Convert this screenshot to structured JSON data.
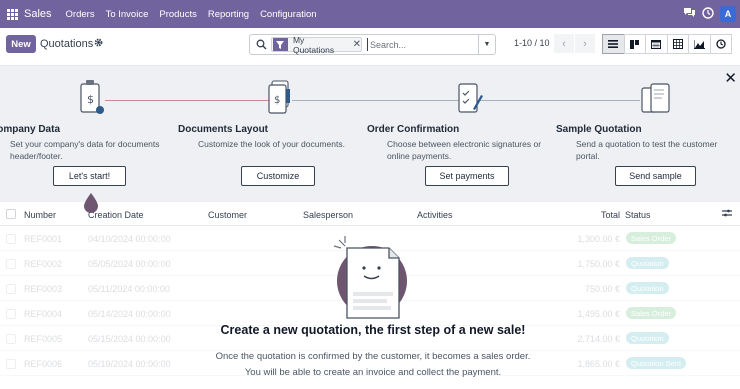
{
  "navbar": {
    "app_name": "Sales",
    "menu": [
      "Orders",
      "To Invoice",
      "Products",
      "Reporting",
      "Configuration"
    ],
    "user_initial": "A",
    "icons": [
      "apps-grid-icon",
      "chat-icon",
      "clock-icon"
    ]
  },
  "control": {
    "new_label": "New",
    "title": "Quotations",
    "search": {
      "facet_label": "My Quotations",
      "placeholder": "Search..."
    },
    "pager": "1-10 / 10",
    "views": [
      "list",
      "kanban",
      "calendar",
      "pivot",
      "graph",
      "activity"
    ]
  },
  "onboarding": {
    "steps": [
      {
        "title": "Company Data",
        "description": "Set your company's data for documents header/footer.",
        "button": "Let's start!"
      },
      {
        "title": "Documents Layout",
        "description": "Customize the look of your documents.",
        "button": "Customize"
      },
      {
        "title": "Order Confirmation",
        "description": "Choose between electronic signatures or online payments.",
        "button": "Set payments"
      },
      {
        "title": "Sample Quotation",
        "description": "Send a quotation to test the customer portal.",
        "button": "Send sample"
      }
    ]
  },
  "list": {
    "columns": [
      "Number",
      "Creation Date",
      "Customer",
      "Salesperson",
      "Activities",
      "Total",
      "Status"
    ],
    "rows": [
      {
        "number": "REF0001",
        "date": "04/10/2024 00:00:00",
        "total": "1,300.00 €",
        "status": "Sales Order",
        "status_color": "#28a745"
      },
      {
        "number": "REF0002",
        "date": "05/05/2024 00:00:00",
        "total": "1,750.00 €",
        "status": "Quotation",
        "status_color": "#17a2b8"
      },
      {
        "number": "REF0003",
        "date": "05/11/2024 00:00:00",
        "total": "750.00 €",
        "status": "Quotation",
        "status_color": "#17a2b8"
      },
      {
        "number": "REF0004",
        "date": "05/14/2024 00:00:00",
        "total": "1,495.00 €",
        "status": "Sales Order",
        "status_color": "#28a745"
      },
      {
        "number": "REF0005",
        "date": "05/15/2024 00:00:00",
        "total": "2,714.00 €",
        "status": "Quotation",
        "status_color": "#17a2b8"
      },
      {
        "number": "REF0006",
        "date": "05/19/2024 00:00:00",
        "total": "1,865.00 €",
        "status": "Quotation Sent",
        "status_color": "#17a2b8"
      }
    ]
  },
  "empty_state": {
    "title": "Create a new quotation, the first step of a new sale!",
    "line1": "Once the quotation is confirmed by the customer, it becomes a sales order.",
    "line2": "You will be able to create an invoice and collect the payment."
  },
  "colors": {
    "brand": "#71639e",
    "onboarding_bg": "#eef0f3",
    "illustration": "#6e5670"
  }
}
